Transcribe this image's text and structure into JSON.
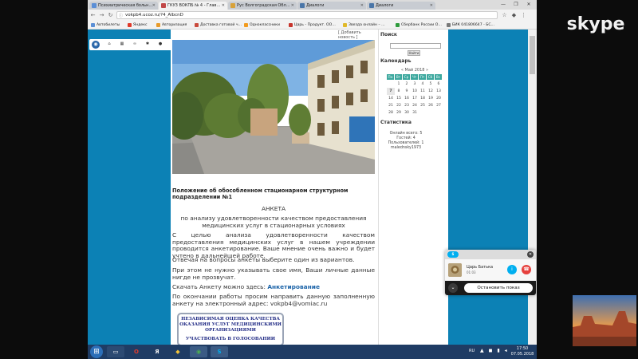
{
  "browser": {
    "tabs": [
      {
        "label": "Психиатрическая больн…",
        "active": false
      },
      {
        "label": "ГКУЗ ВОКПБ № 4 - Глав…",
        "active": true
      },
      {
        "label": "Рус Волгоградская Обл…",
        "active": false
      },
      {
        "label": "Диалоги",
        "active": false
      },
      {
        "label": "Диалоги",
        "active": false
      }
    ],
    "url": "vokpb4.ucoz.ru/?4_AlbcnD",
    "bookmarks": [
      "Автобилеты",
      "Яндекс",
      "Авторизация",
      "Доставка готовой ч…",
      "Одноклассники",
      "Царь - Продукт. ОО…",
      "Звезда онлайн – …",
      "Сбербанк России О…",
      "БИК 041806647 - БС…"
    ]
  },
  "page": {
    "add_news": "[ Добавить новость ]",
    "doc_title": "Положение об обособленном стационарном структурном подразделении №1",
    "anketa": "АНКЕТА",
    "subtitle": "по анализу удовлетворенности качеством предоставления медицинских услуг в стационарных условиях",
    "para1": "С целью анализа удовлетворенности качеством предоставления медицинских услуг в нашем учреждении проводится анкетирование. Ваше мнение очень важно и будет учтено в дальнейшей работе.",
    "para2": "Отвечая на вопросы анкеты выберите один из вариантов.",
    "para3": "При этом не нужно указывать свое имя, Ваши личные данные нигде не прозвучат.",
    "download_prefix": "Скачать Анкету можно здесь:",
    "download_link": "Анкетирование",
    "para4": "По окончании работы просим направить данную заполненную анкету на электронный адрес: vokpb4@vomiac.ru",
    "banner_line1": "НЕЗАВИСИМАЯ ОЦЕНКА КАЧЕСТВА",
    "banner_line2": "ОКАЗАНИЯ УСЛУГ МЕДИЦИНСКИМИ",
    "banner_line3": "ОРГАНИЗАЦИЯМИ",
    "banner_line4": "УЧАСТВОВАТЬ В ГОЛОСОВАНИИ"
  },
  "sidebar": {
    "search_title": "Поиск",
    "search_button": "Найти",
    "calendar_title": "Календарь",
    "calendar_month": "« Май 2018 »",
    "weekdays": [
      "Пн",
      "Вт",
      "Ср",
      "Чт",
      "Пт",
      "Сб",
      "Вс"
    ],
    "days": [
      "",
      "1",
      "2",
      "3",
      "4",
      "5",
      "6",
      "7",
      "8",
      "9",
      "10",
      "11",
      "12",
      "13",
      "14",
      "15",
      "16",
      "17",
      "18",
      "19",
      "20",
      "21",
      "22",
      "23",
      "24",
      "25",
      "26",
      "27",
      "28",
      "29",
      "30",
      "31",
      "",
      "",
      ""
    ],
    "today": "7",
    "stats_title": "Статистика",
    "online": "Онлайн всего: 5",
    "guests": "Гостей: 4",
    "users": "Пользователей: 1",
    "username": "malednsky1973"
  },
  "skype": {
    "logo": "skype",
    "call_badge": "S",
    "caller_name": "Царь Батька",
    "call_time": "01:03",
    "stop_label": "Остановить показ"
  },
  "taskbar": {
    "lang": "RU",
    "time": "17:50",
    "date": "07.05.2018"
  },
  "colors": {
    "page_bg": "#0c81b5",
    "calendar_header": "#3ca89e",
    "link": "#1b63a8",
    "end_call": "#e6403d",
    "skype_blue": "#00aff0",
    "taskbar": "#1f3c64"
  }
}
